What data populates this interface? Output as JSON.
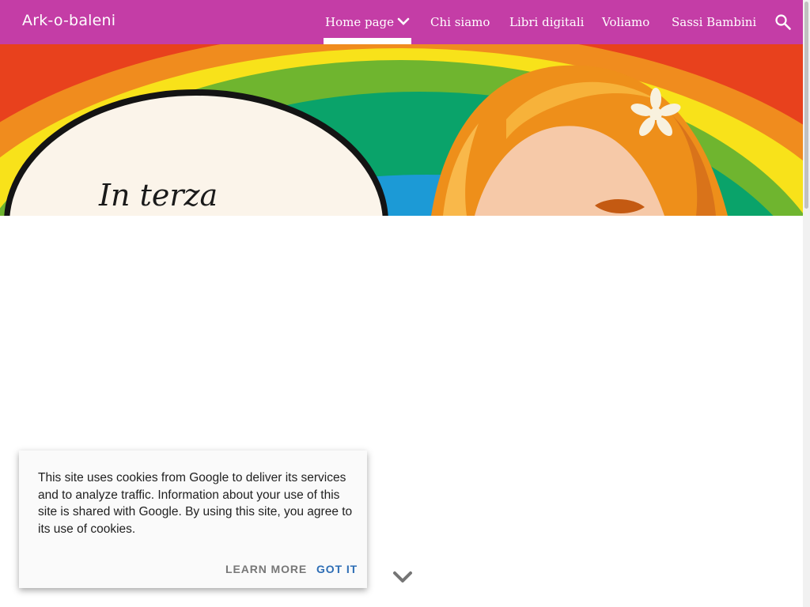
{
  "header": {
    "site_title": "Ark-o-baleni",
    "nav": [
      {
        "label": "Home page",
        "active": true
      },
      {
        "label": "Chi siamo"
      },
      {
        "label": "Libri digitali"
      },
      {
        "label": "Voliamo"
      },
      {
        "label": "Sassi Bambini"
      }
    ],
    "icons": {
      "dropdown": "chevron-down-icon",
      "search": "search-icon"
    }
  },
  "hero": {
    "handwritten_text": "In terza"
  },
  "cookie_notice": {
    "message": "This site uses cookies from Google to deliver its services and to analyze traffic. Information about your use of this site is shared with Google. By using this site, you agree to its use of cookies.",
    "learn_more": "LEARN MORE",
    "got_it": "GOT IT"
  },
  "colors": {
    "header_bg": "#c43da6",
    "accent_button": "#2d6db5"
  }
}
